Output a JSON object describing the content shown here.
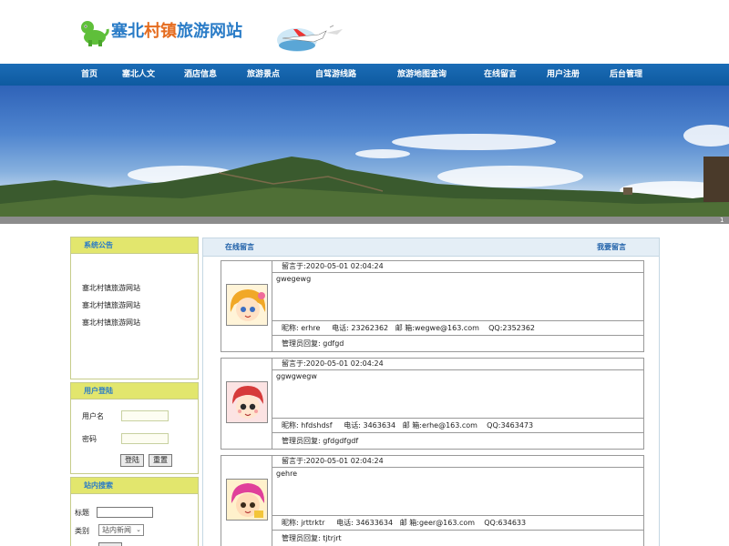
{
  "header": {
    "title_part1": "塞北",
    "title_part2": "村镇",
    "title_part3": "旅游网站"
  },
  "nav": {
    "items": [
      "首页",
      "塞北人文",
      "酒店信息",
      "旅游景点",
      "自驾游线路",
      "旅游地图查询",
      "在线留言",
      "用户注册",
      "后台管理"
    ]
  },
  "banner": {
    "corner_number": "1"
  },
  "sidebar": {
    "notice": {
      "title": "系统公告",
      "items": [
        "塞北村镇旅游网站",
        "塞北村镇旅游网站",
        "塞北村镇旅游网站"
      ]
    },
    "login": {
      "title": "用户登陆",
      "username_label": "用户名",
      "password_label": "密码",
      "login_button": "登陆",
      "reset_button": "重置"
    },
    "search": {
      "title": "站内搜索",
      "keyword_label": "标题",
      "category_label": "类别",
      "category_selected": "站内新闻"
    }
  },
  "main": {
    "title": "在线留言",
    "write_link": "我要留言",
    "messages": [
      {
        "time": "留言于:2020-05-01 02:04:24",
        "content": "gwegewg",
        "nickname_label": "昵称:",
        "nickname": "erhre",
        "phone_label": "电话:",
        "phone": "23262362",
        "email_label": "邮 箱:",
        "email": "wegwe@163.com",
        "qq_label": "QQ:",
        "qq": "2352362",
        "reply_label": "管理员回复:",
        "reply": "gdfgd",
        "avatar_icon": "cartoon-girl-avatar"
      },
      {
        "time": "留言于:2020-05-01 02:04:24",
        "content": "ggwgwegw",
        "nickname_label": "昵称:",
        "nickname": "hfdshdsf",
        "phone_label": "电话:",
        "phone": "3463634",
        "email_label": "邮 箱:",
        "email": "erhe@163.com",
        "qq_label": "QQ:",
        "qq": "3463473",
        "reply_label": "管理员回复:",
        "reply": "gfdgdfgdf",
        "avatar_icon": "cartoon-girl-avatar"
      },
      {
        "time": "留言于:2020-05-01 02:04:24",
        "content": "gehre",
        "nickname_label": "昵称:",
        "nickname": "jrttrktr",
        "phone_label": "电话:",
        "phone": "34633634",
        "email_label": "邮 箱:",
        "email": "geer@163.com",
        "qq_label": "QQ:",
        "qq": "634633",
        "reply_label": "管理员回复:",
        "reply": "tjtrjrt",
        "avatar_icon": "cartoon-girl-avatar"
      }
    ]
  },
  "colors": {
    "nav_blue": "#1b6cb6",
    "sidebar_header": "#e2e66d",
    "title_blue": "#2a7cc7",
    "title_orange": "#e56c1f"
  }
}
